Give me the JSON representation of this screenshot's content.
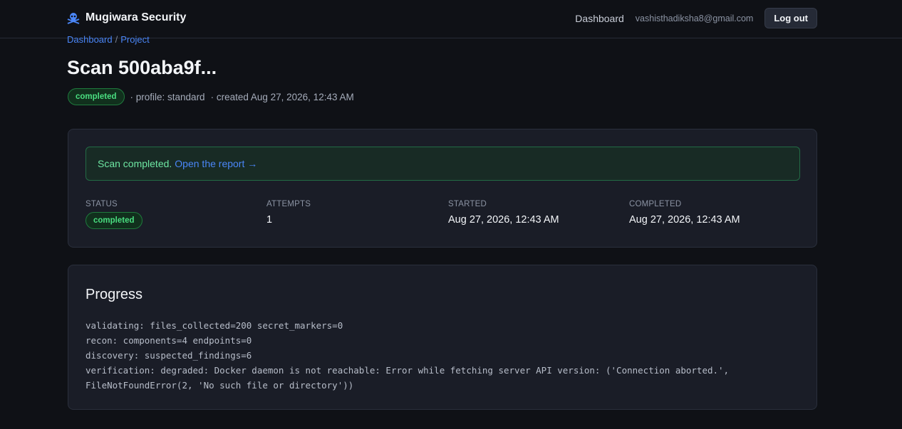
{
  "header": {
    "brand": "Mugiwara Security",
    "brand_icon": "skull-crossbones-icon",
    "nav_dashboard": "Dashboard",
    "user_email": "vashisthadiksha8@gmail.com",
    "logout_label": "Log out"
  },
  "breadcrumb": {
    "dashboard": "Dashboard",
    "separator": "/",
    "project": "Project"
  },
  "page": {
    "title": "Scan 500aba9f...",
    "status_badge": "completed",
    "profile": "· profile: standard",
    "created": "· created Aug 27, 2026, 12:43 AM"
  },
  "alert": {
    "message": "Scan completed.",
    "link": "Open the report →"
  },
  "stats": [
    {
      "label": "STATUS",
      "value": "completed"
    },
    {
      "label": "ATTEMPTS",
      "value": "1"
    },
    {
      "label": "STARTED",
      "value": "Aug 27, 2026, 12:43 AM"
    },
    {
      "label": "COMPLETED",
      "value": "Aug 27, 2026, 12:43 AM"
    }
  ],
  "progress": {
    "title": "Progress",
    "lines": [
      "validating: files_collected=200 secret_markers=0",
      "recon: components=4 endpoints=0",
      "discovery: suspected_findings=6",
      "verification: degraded: Docker daemon is not reachable: Error while fetching server API version: ('Connection aborted.',",
      "FileNotFoundError(2, 'No such file or directory'))"
    ]
  },
  "colors": {
    "background": "#0f1116",
    "card": "#1a1d27",
    "success": "#4ade80",
    "link": "#4a86f7",
    "brand_icon": "#4a86f7"
  }
}
